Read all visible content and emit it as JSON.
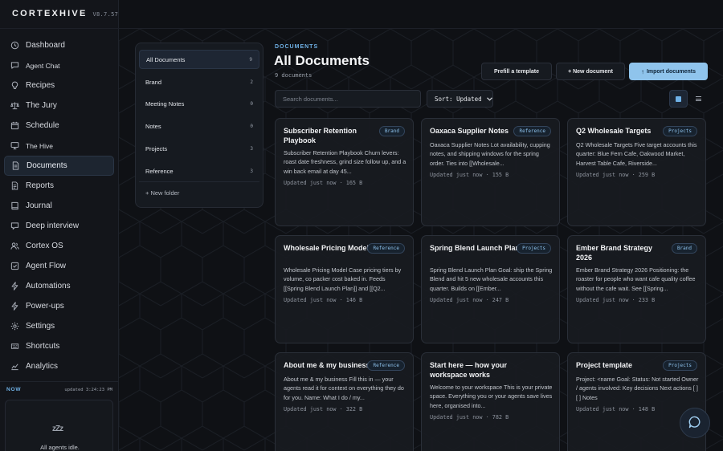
{
  "app": {
    "name": "CORTEXHIVE",
    "version": "V8.7.57"
  },
  "sidebar": {
    "items": [
      {
        "label": "Dashboard",
        "icon": "clock-icon"
      },
      {
        "label": "Agent Chat",
        "icon": "chat-icon"
      },
      {
        "label": "Recipes",
        "icon": "bulb-icon"
      },
      {
        "label": "The Jury",
        "icon": "scale-icon"
      },
      {
        "label": "Schedule",
        "icon": "calendar-icon"
      },
      {
        "label": "The Hive",
        "icon": "monitor-icon"
      },
      {
        "label": "Documents",
        "icon": "document-icon"
      },
      {
        "label": "Reports",
        "icon": "report-icon"
      },
      {
        "label": "Journal",
        "icon": "book-icon"
      },
      {
        "label": "Deep interview",
        "icon": "message-icon"
      },
      {
        "label": "Cortex OS",
        "icon": "users-icon"
      },
      {
        "label": "Agent Flow",
        "icon": "checkbox-icon"
      },
      {
        "label": "Automations",
        "icon": "bolt-icon"
      },
      {
        "label": "Power-ups",
        "icon": "bolt-icon"
      },
      {
        "label": "Settings",
        "icon": "gear-icon"
      },
      {
        "label": "Shortcuts",
        "icon": "keyboard-icon"
      },
      {
        "label": "Analytics",
        "icon": "chart-icon"
      }
    ],
    "active": "Documents"
  },
  "now_panel": {
    "label": "NOW",
    "updated": "updated 3:24:23 PM",
    "zzz": "zZz",
    "status": "All agents idle."
  },
  "folders": {
    "items": [
      {
        "label": "All Documents",
        "count": "9"
      },
      {
        "label": "Brand",
        "count": "2"
      },
      {
        "label": "Meeting Notes",
        "count": "0"
      },
      {
        "label": "Notes",
        "count": "0"
      },
      {
        "label": "Projects",
        "count": "3"
      },
      {
        "label": "Reference",
        "count": "3"
      }
    ],
    "new_folder": "+ New folder"
  },
  "header": {
    "crumb": "DOCUMENTS",
    "title": "All Documents",
    "subtitle": "9 documents"
  },
  "actions": {
    "prefill": "Prefill a template",
    "new_doc": "+ New document",
    "import": "Import documents",
    "import_icon": "↑"
  },
  "search": {
    "placeholder": "Search documents..."
  },
  "sort": {
    "label": "Sort: Updated"
  },
  "accent": "#6fb1e6",
  "documents": [
    {
      "title": "Subscriber Retention Playbook",
      "tag": "Brand",
      "excerpt": "Subscriber Retention Playbook Churn levers: roast date freshness, grind size follow up, and a win back email at day 45...",
      "meta": "Updated just now · 165 B"
    },
    {
      "title": "Oaxaca Supplier Notes",
      "tag": "Reference",
      "excerpt": "Oaxaca Supplier Notes Lot availability, cupping notes, and shipping windows for the spring order. Ties into [[Wholesale...",
      "meta": "Updated just now · 155 B"
    },
    {
      "title": "Q2 Wholesale Targets",
      "tag": "Projects",
      "excerpt": "Q2 Wholesale Targets Five target accounts this quarter: Blue Fern Cafe, Oakwood Market, Harvest Table Cafe, Riverside...",
      "meta": "Updated just now · 259 B"
    },
    {
      "title": "Wholesale Pricing Model",
      "tag": "Reference",
      "excerpt": "Wholesale Pricing Model Case pricing tiers by volume, co packer cost baked in. Feeds [[Spring Blend Launch Plan]] and [[Q2...",
      "meta": "Updated just now · 146 B"
    },
    {
      "title": "Spring Blend Launch Plan",
      "tag": "Projects",
      "excerpt": "Spring Blend Launch Plan Goal: ship the Spring Blend and hit 5 new wholesale accounts this quarter. Builds on [[Ember...",
      "meta": "Updated just now · 247 B"
    },
    {
      "title": "Ember Brand Strategy 2026",
      "tag": "Brand",
      "excerpt": "Ember Brand Strategy 2026 Positioning: the roaster for people who want cafe quality coffee without the cafe wait. See [[Spring...",
      "meta": "Updated just now · 233 B"
    },
    {
      "title": "About me & my business",
      "tag": "Reference",
      "excerpt": "About me & my business Fill this in — your agents read it for context on everything they do for you. Name: What I do / my...",
      "meta": "Updated just now · 322 B"
    },
    {
      "title": "Start here — how your workspace works",
      "tag": "",
      "excerpt": "Welcome to your workspace This is your private space. Everything you or your agents save lives here, organised into...",
      "meta": "Updated just now · 782 B"
    },
    {
      "title": "Project template",
      "tag": "Projects",
      "excerpt": "Project: <name Goal: Status: Not started Owner / agents involved: Key decisions Next actions [ ] [ ] Notes",
      "meta": "Updated just now · 148 B"
    }
  ]
}
